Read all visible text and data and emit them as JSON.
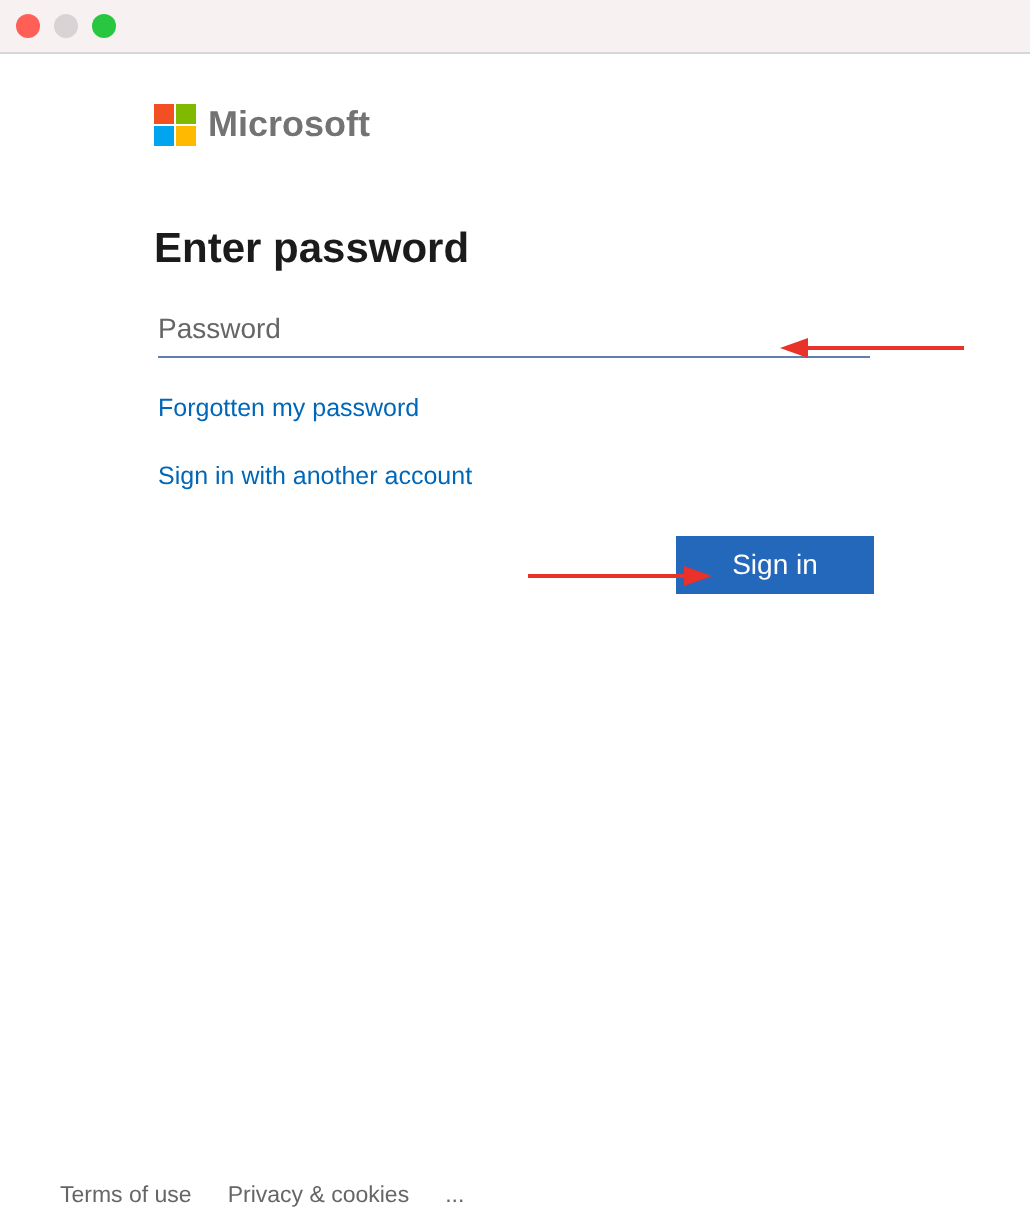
{
  "window": {
    "controls": [
      {
        "color": "#fe5f57"
      },
      {
        "color": "#d8d3d4"
      },
      {
        "color": "#29c73f"
      }
    ]
  },
  "brand": {
    "name": "Microsoft"
  },
  "heading": "Enter password",
  "password_field": {
    "placeholder": "Password"
  },
  "links": [
    "Forgotten my password",
    "Sign in with another account"
  ],
  "sign_in_button": "Sign in",
  "footer": [
    "Terms of use",
    "Privacy & cookies",
    "..."
  ]
}
